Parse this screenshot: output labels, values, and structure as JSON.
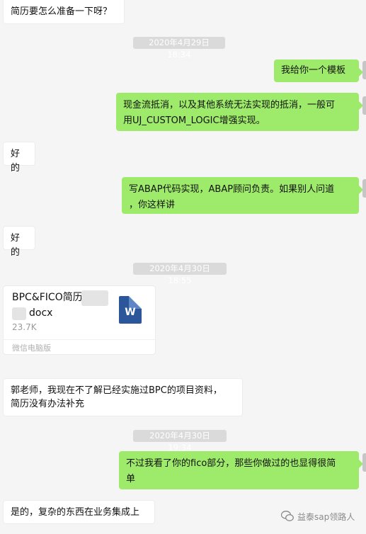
{
  "messages": {
    "m1": "简历要怎么准备一下呀？",
    "t1": "2020年4月29日 18:34",
    "m2": "我给你一个模板",
    "m3_l1": "现金流抵消，以及其他系统无法实现的抵消，一般可",
    "m3_l2": "用UJ_CUSTOM_LOGIC增强实现。",
    "m4": "好的",
    "m5_l1": "写ABAP代码实现，ABAP顾问负责。如果别人问道",
    "m5_l2": "，你这样讲",
    "m6": "好的",
    "t2": "2020年4月30日 18:55",
    "file": {
      "name_l1": "BPC&FICO简历·",
      "name_l2": "docx",
      "size": "23.7K",
      "source": "微信电脑版",
      "icon_letter": "W"
    },
    "m7_l1": "郭老师，我现在不了解已经实施过BPC的项目资料，",
    "m7_l2": "简历没有办法补充",
    "t3": "2020年4月30日 19:34",
    "m8_l1": "不过我看了你的fico部分，那些你做过的也显得很简",
    "m8_l2": "单",
    "m9": "是的，复杂的东西在业务集成上"
  },
  "watermark": "益泰sap领路人",
  "colors": {
    "background": "#f5f5f5",
    "bubble_self": "#9eea6a",
    "bubble_other": "#ffffff",
    "timestamp_bg": "#dadada",
    "word_icon": "#2b579a"
  }
}
